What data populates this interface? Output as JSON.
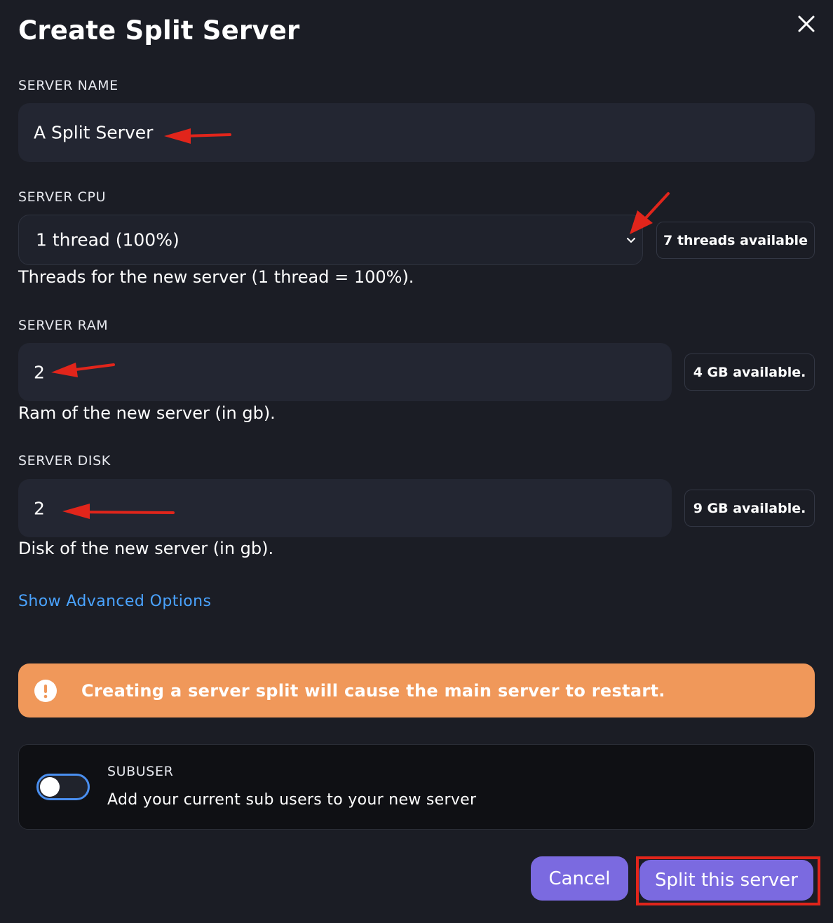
{
  "dialog": {
    "title": "Create Split Server",
    "close_icon": "close-icon"
  },
  "fields": {
    "name": {
      "label": "SERVER NAME",
      "value": "A Split Server"
    },
    "cpu": {
      "label": "SERVER CPU",
      "selected": "1 thread (100%)",
      "available": "7 threads available",
      "help": "Threads for the new server (1 thread = 100%)."
    },
    "ram": {
      "label": "SERVER RAM",
      "value": "2",
      "available": "4 GB available.",
      "help": "Ram of the new server (in gb)."
    },
    "disk": {
      "label": "SERVER DISK",
      "value": "2",
      "available": "9 GB available.",
      "help": "Disk of the new server (in gb)."
    }
  },
  "advanced_link": "Show Advanced Options",
  "alert": {
    "message": "Creating a server split will cause the main server to restart.",
    "icon": "exclamation-icon",
    "color": "#f0985a"
  },
  "subuser": {
    "title": "SUBUSER",
    "description": "Add your current sub users to your new server",
    "enabled": false
  },
  "buttons": {
    "cancel": "Cancel",
    "submit": "Split this server"
  },
  "colors": {
    "background": "#1b1d25",
    "field": "#232632",
    "accent": "#7b6ae0",
    "link": "#4aa3ff",
    "annotation": "#e1251b"
  }
}
